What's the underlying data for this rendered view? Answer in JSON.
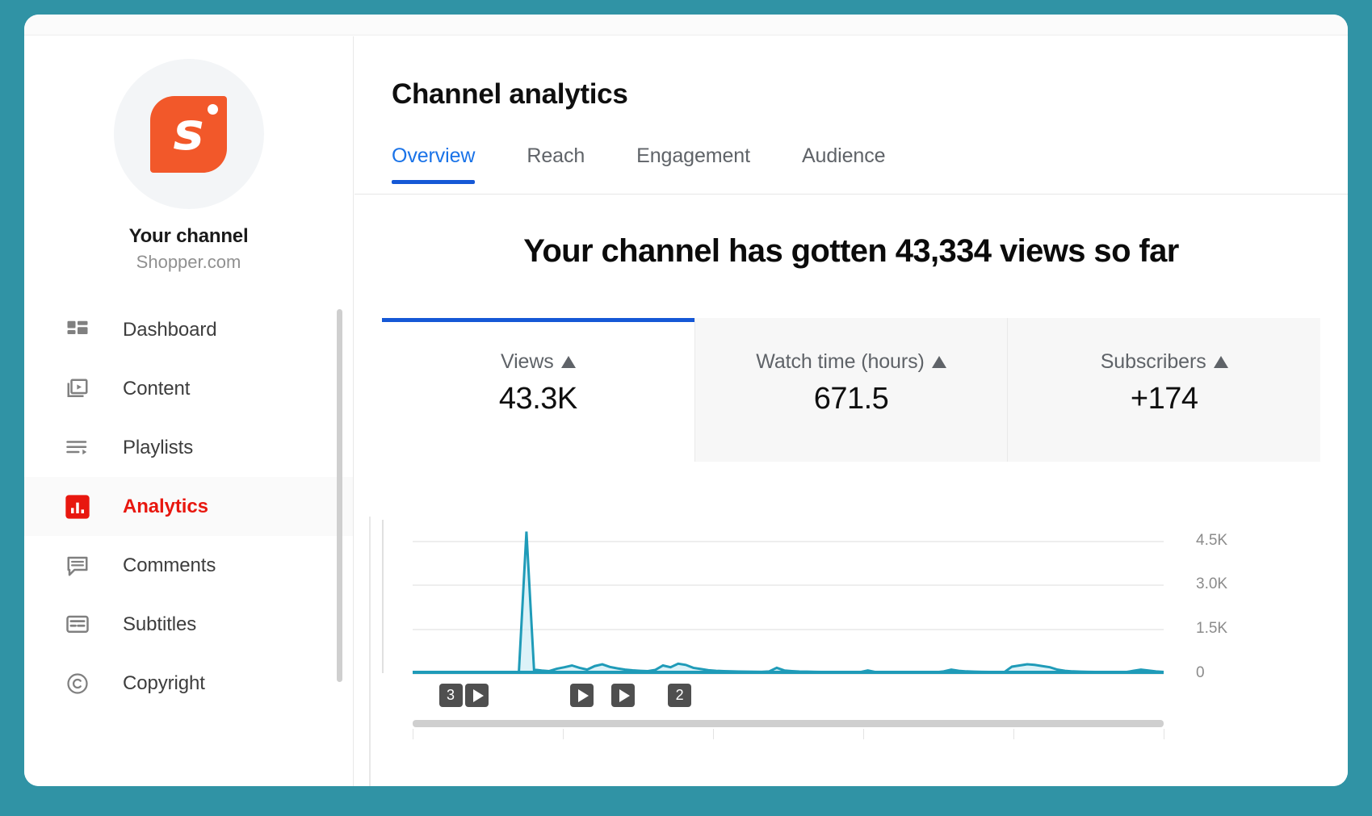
{
  "window": {
    "accent_border_color": "#3093a5"
  },
  "sidebar": {
    "logo": {
      "icon": "shopper-logo-icon",
      "letter": "s",
      "bg_color": "#f2582a"
    },
    "channel_name": "Your channel",
    "channel_handle": "Shopper.com",
    "items": [
      {
        "label": "Dashboard",
        "icon": "dashboard-icon",
        "active": false
      },
      {
        "label": "Content",
        "icon": "content-icon",
        "active": false
      },
      {
        "label": "Playlists",
        "icon": "playlists-icon",
        "active": false
      },
      {
        "label": "Analytics",
        "icon": "analytics-icon",
        "active": true
      },
      {
        "label": "Comments",
        "icon": "comments-icon",
        "active": false
      },
      {
        "label": "Subtitles",
        "icon": "subtitles-icon",
        "active": false
      },
      {
        "label": "Copyright",
        "icon": "copyright-icon",
        "active": false
      }
    ],
    "active_color": "#e8170f"
  },
  "main": {
    "page_title": "Channel analytics",
    "tabs": [
      {
        "label": "Overview",
        "active": true
      },
      {
        "label": "Reach",
        "active": false
      },
      {
        "label": "Engagement",
        "active": false
      },
      {
        "label": "Audience",
        "active": false
      }
    ],
    "active_tab_color": "#1a73e8",
    "headline": "Your channel has gotten 43,334 views so far",
    "cards": [
      {
        "label": "Views",
        "value": "43.3K",
        "active": true,
        "indicator": "triangle-up-icon"
      },
      {
        "label": "Watch time (hours)",
        "value": "671.5",
        "active": false,
        "indicator": "triangle-up-icon"
      },
      {
        "label": "Subscribers",
        "value": "+174",
        "active": false,
        "indicator": "triangle-up-icon"
      }
    ],
    "markers": [
      {
        "label": "3",
        "type": "count",
        "x_pct": 3.5
      },
      {
        "label": "",
        "type": "play",
        "x_pct": 7.0
      },
      {
        "label": "",
        "type": "play",
        "x_pct": 21.0
      },
      {
        "label": "",
        "type": "play",
        "x_pct": 26.5
      },
      {
        "label": "2",
        "type": "count",
        "x_pct": 34.0
      }
    ]
  },
  "chart_data": {
    "type": "line",
    "title": "",
    "xlabel": "",
    "ylabel": "",
    "line_color": "#1f9bb8",
    "fill_color": "#bfe8f2",
    "grid": true,
    "ylim": [
      0,
      5200
    ],
    "yticks": [
      0,
      1500,
      3000,
      4500
    ],
    "ytick_labels": [
      "0",
      "1.5K",
      "3.0K",
      "4.5K"
    ],
    "x": [
      0,
      1,
      2,
      3,
      4,
      5,
      6,
      7,
      8,
      9,
      10,
      11,
      12,
      13,
      14,
      15,
      16,
      17,
      18,
      19,
      20,
      21,
      22,
      23,
      24,
      25,
      26,
      27,
      28,
      29,
      30,
      31,
      32,
      33,
      34,
      35,
      36,
      37,
      38,
      39,
      40,
      41,
      42,
      43,
      44,
      45,
      46,
      47,
      48,
      49,
      50,
      51,
      52,
      53,
      54,
      55,
      56,
      57,
      58,
      59,
      60,
      61,
      62,
      63,
      64,
      65,
      66,
      67,
      68,
      69,
      70,
      71,
      72,
      73,
      74,
      75,
      76,
      77,
      78,
      79,
      80,
      81,
      82,
      83,
      84,
      85,
      86,
      87,
      88,
      89,
      90,
      91,
      92,
      93,
      94,
      95,
      96,
      97,
      98,
      99
    ],
    "values": [
      20,
      18,
      22,
      25,
      20,
      18,
      22,
      20,
      19,
      21,
      24,
      20,
      18,
      20,
      22,
      4800,
      120,
      90,
      70,
      150,
      200,
      260,
      180,
      120,
      240,
      300,
      210,
      160,
      120,
      95,
      80,
      70,
      110,
      260,
      200,
      320,
      280,
      180,
      140,
      100,
      80,
      70,
      60,
      55,
      50,
      48,
      45,
      60,
      180,
      90,
      70,
      55,
      50,
      45,
      42,
      40,
      38,
      36,
      35,
      34,
      90,
      40,
      38,
      36,
      35,
      34,
      33,
      32,
      31,
      30,
      60,
      120,
      80,
      60,
      50,
      45,
      40,
      38,
      36,
      220,
      260,
      300,
      280,
      240,
      200,
      120,
      80,
      60,
      50,
      45,
      40,
      38,
      36,
      35,
      34,
      80,
      120,
      90,
      60,
      40
    ],
    "peak": {
      "index": 15,
      "value": 4800
    }
  }
}
